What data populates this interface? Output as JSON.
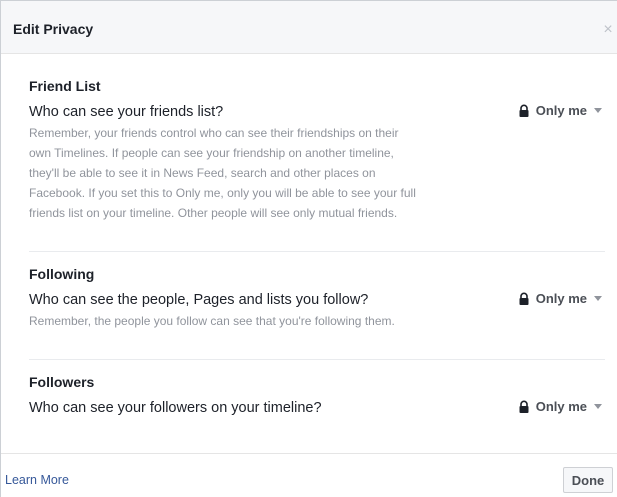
{
  "dialog": {
    "title": "Edit Privacy",
    "close_label": "×"
  },
  "sections": [
    {
      "title": "Friend List",
      "question": "Who can see your friends list?",
      "description": "Remember, your friends control who can see their friendships on their own Timelines. If people can see your friendship on another timeline, they'll be able to see it in News Feed, search and other places on Facebook. If you set this to Only me, only you will be able to see your full friends list on your timeline. Other people will see only mutual friends.",
      "audience": "Only me"
    },
    {
      "title": "Following",
      "question": "Who can see the people, Pages and lists you follow?",
      "description": "Remember, the people you follow can see that you're following them.",
      "audience": "Only me"
    },
    {
      "title": "Followers",
      "question": "Who can see your followers on your timeline?",
      "description": "",
      "audience": "Only me"
    }
  ],
  "footer": {
    "learn_more": "Learn More",
    "done": "Done"
  },
  "icons": {
    "audience": "lock-icon",
    "dropdown": "caret-down-icon",
    "close": "close-icon"
  },
  "colors": {
    "link": "#365899",
    "header_bg": "#f6f7f9",
    "secondary_text": "#90949c"
  }
}
